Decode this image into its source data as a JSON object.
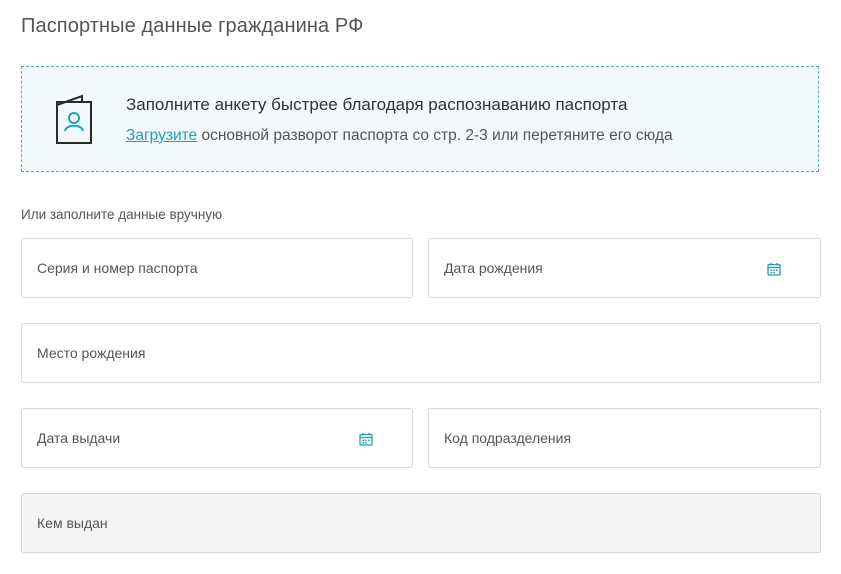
{
  "page_title": "Паспортные данные гражданина РФ",
  "upload": {
    "title": "Заполните анкету быстрее благодаря распознаванию паспорта",
    "link_text": "Загрузите",
    "subtitle_rest": " основной разворот паспорта со стр. 2-3 или перетяните его сюда",
    "icon": "passport-icon"
  },
  "manual_label": "Или заполните данные вручную",
  "fields": {
    "series_number": "Серия и номер паспорта",
    "birth_date": "Дата рождения",
    "birth_place": "Место рождения",
    "issue_date": "Дата выдачи",
    "division_code": "Код подразделения",
    "issued_by": "Кем выдан"
  },
  "colors": {
    "accent": "#1fa2b3",
    "border_dashed": "#4fb2b2",
    "upload_bg": "#f3f8fa",
    "field_border": "#d5d8db",
    "disabled_bg": "#f4f4f4"
  }
}
